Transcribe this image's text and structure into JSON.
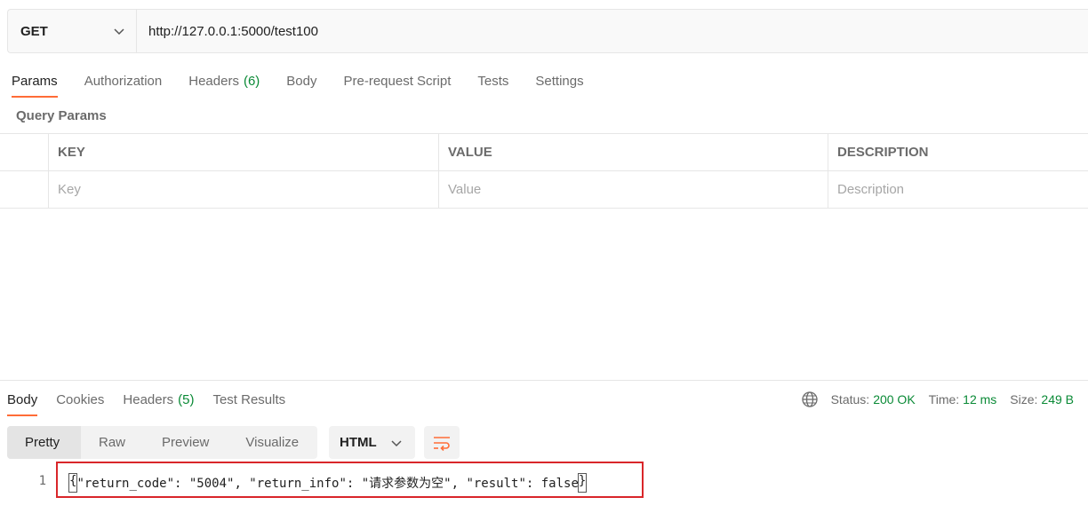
{
  "request": {
    "method": "GET",
    "url": "http://127.0.0.1:5000/test100"
  },
  "request_tabs": [
    {
      "label": "Params",
      "active": true
    },
    {
      "label": "Authorization"
    },
    {
      "label": "Headers",
      "count": "(6)"
    },
    {
      "label": "Body"
    },
    {
      "label": "Pre-request Script"
    },
    {
      "label": "Tests"
    },
    {
      "label": "Settings"
    }
  ],
  "query_params": {
    "title": "Query Params",
    "headers": {
      "key": "KEY",
      "value": "VALUE",
      "description": "DESCRIPTION"
    },
    "placeholders": {
      "key": "Key",
      "value": "Value",
      "description": "Description"
    }
  },
  "response_tabs": [
    {
      "label": "Body",
      "active": true
    },
    {
      "label": "Cookies"
    },
    {
      "label": "Headers",
      "count": "(5)"
    },
    {
      "label": "Test Results"
    }
  ],
  "status": {
    "status_label": "Status:",
    "status_value": "200 OK",
    "time_label": "Time:",
    "time_value": "12 ms",
    "size_label": "Size:",
    "size_value": "249 B"
  },
  "view_modes": [
    "Pretty",
    "Raw",
    "Preview",
    "Visualize"
  ],
  "format": "HTML",
  "code": {
    "line_number": "1",
    "open_brace": "{",
    "content": "\"return_code\": \"5004\", \"return_info\": \"请求参数为空\", \"result\": false",
    "close_brace": "}"
  },
  "colors": {
    "accent": "#ff6c37",
    "success": "#0a8a36",
    "highlight_box": "#d9262a"
  }
}
